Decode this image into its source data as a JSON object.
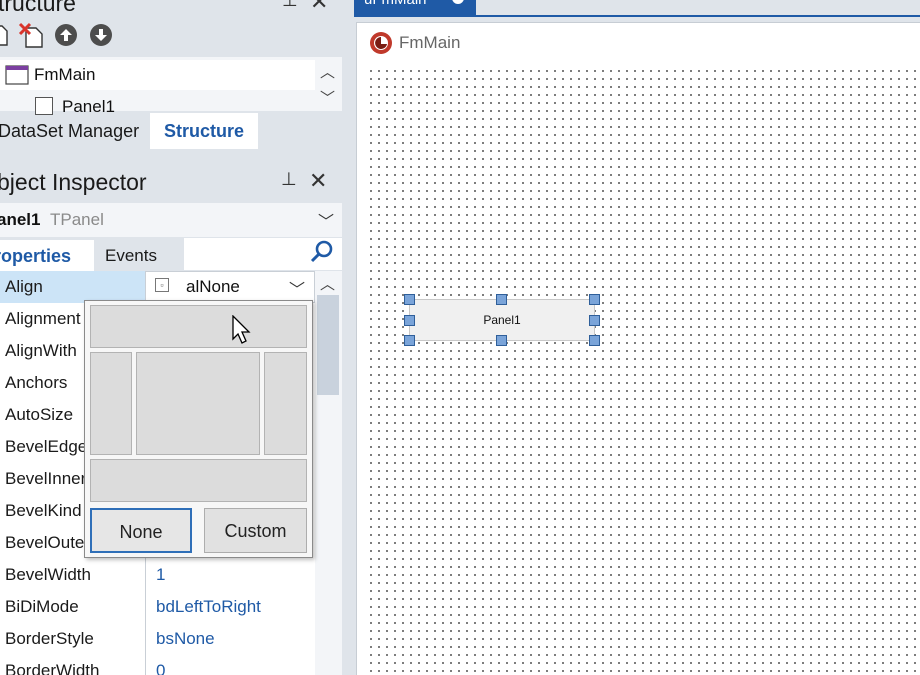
{
  "structure": {
    "title": "tructure",
    "tree": {
      "item1": "FmMain",
      "item2": "Panel1"
    },
    "tabs": [
      "DataSet Manager",
      "Structure"
    ]
  },
  "inspector": {
    "title": "bject Inspector",
    "object_name": "anel1",
    "object_type": "TPanel",
    "tabs": [
      "roperties",
      "Events"
    ],
    "align_value": "alNone",
    "properties": [
      {
        "name": "Align",
        "value": ""
      },
      {
        "name": "Alignment",
        "value": ""
      },
      {
        "name": "AlignWith",
        "value": ""
      },
      {
        "name": "Anchors",
        "value": ""
      },
      {
        "name": "AutoSize",
        "value": ""
      },
      {
        "name": "BevelEdge",
        "value": ""
      },
      {
        "name": "BevelInner",
        "value": ""
      },
      {
        "name": "BevelKind",
        "value": ""
      },
      {
        "name": "BevelOute",
        "value": ""
      },
      {
        "name": "BevelWidth",
        "value": "1"
      },
      {
        "name": "BiDiMode",
        "value": "bdLeftToRight"
      },
      {
        "name": "BorderStyle",
        "value": "bsNone"
      },
      {
        "name": "BorderWidth",
        "value": "0"
      }
    ]
  },
  "align_popup": {
    "none_label": "None",
    "custom_label": "Custom"
  },
  "designer": {
    "doc_tab": "uFmMain",
    "form_title": "FmMain",
    "panel_caption": "Panel1"
  },
  "colors": {
    "accent": "#1f5aa6",
    "selection_handle": "#7aa4d9",
    "row_highlight": "#cce4f7"
  }
}
